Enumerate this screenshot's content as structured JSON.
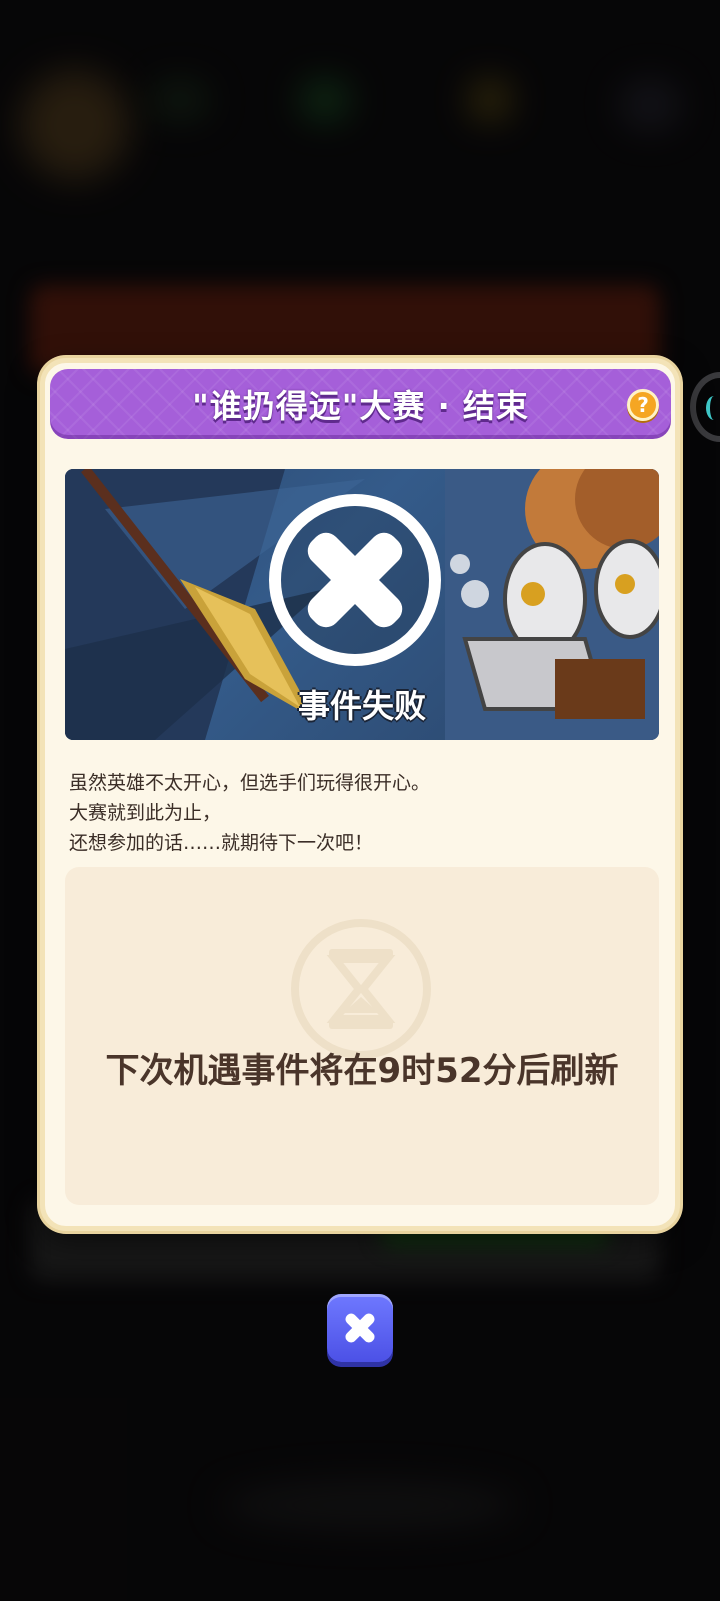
{
  "dialog": {
    "title": "\"谁扔得远\"大赛 · 结束",
    "help_glyph": "?",
    "banner_label": "事件失败",
    "message_lines": [
      "虽然英雄不太开心，但选手们玩得很开心。",
      "大赛就到此为止，",
      "还想参加的话……就期待下一次吧！"
    ],
    "refresh_text": "下次机遇事件将在9时52分后刷新"
  },
  "icons": {
    "help": "question-mark-icon",
    "banner_fail": "fail-x-circle-icon",
    "timer": "hourglass-icon",
    "close": "close-x-icon"
  },
  "colors": {
    "title_bar": "#a55fd9",
    "dialog_bg": "#fdf7e8",
    "close_button": "#5a60f0",
    "help_button": "#f5a623"
  }
}
